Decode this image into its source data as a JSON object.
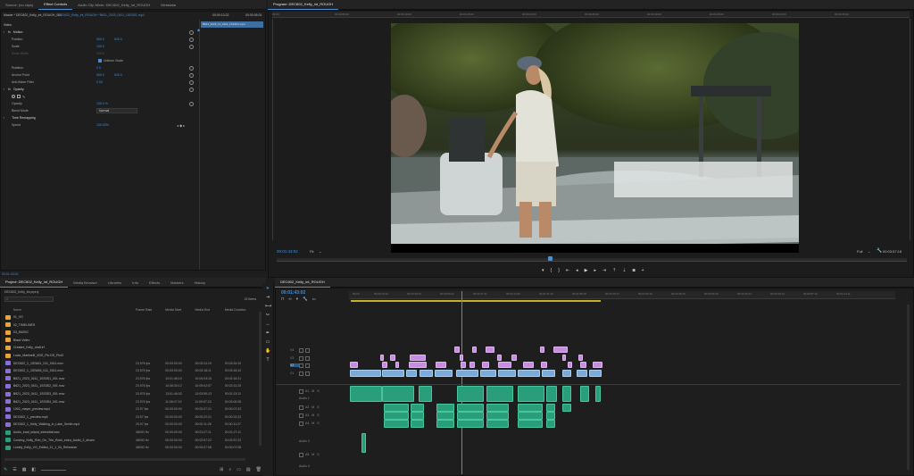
{
  "source_tabs": {
    "source": "Source: (no clips)",
    "effect_controls": "Effect Controls",
    "audio_mixer": "Audio Clip Mixer: DEC602_Kelly_int_ROUGH",
    "metadata": "Metadata"
  },
  "effect_controls": {
    "master_label": "Master * DEC602_Kelly_int_ROUGH_001",
    "clip_label": "DEC602_Kelly_int_ROUGH * B621_2023_0411_1SS3S1.mp4",
    "timecode_start": "00:00:13:22",
    "timecode_end": "00:00:05:01",
    "clip_chip": "B621_2023_11_0411_1SS3S1.mp4",
    "section_video": "Video",
    "motion": "Motion",
    "position_label": "Position",
    "position_x": "960.0",
    "position_y": "540.0",
    "scale_label": "Scale",
    "scale_value": "100.0",
    "scale_width_label": "Scale Width",
    "scale_width_value": "100.0",
    "uniform_label": "Uniform Scale",
    "rotation_label": "Rotation",
    "rotation_value": "0.0",
    "anchor_label": "Anchor Point",
    "anchor_x": "960.0",
    "anchor_y": "540.0",
    "anti_flicker_label": "Anti-flicker Filter",
    "anti_flicker_value": "0.00",
    "opacity": "Opacity",
    "opacity_label": "Opacity",
    "opacity_value": "100.0 %",
    "blend_label": "Blend Mode",
    "blend_value": "Normal",
    "time_remap": "Time Remapping",
    "speed_label": "Speed",
    "speed_value": "100.00%",
    "bottom_timecode": "00:01:43:02"
  },
  "program": {
    "title": "Program: DEC602_Kelly_int_ROUGH",
    "timecode": "00:01:43:02",
    "fit": "Fit",
    "quality": "Full",
    "duration": "00:03:57:18",
    "ruler_ticks": [
      "00:00",
      "00:00:05:00",
      "00:00:10:00",
      "00:00:15:00",
      "00:00:20:00",
      "00:00:25:00",
      "00:00:30:00",
      "00:00:35:00",
      "00:00:40:00",
      "00:00:45:00"
    ]
  },
  "project": {
    "tabs": [
      "Project: DEC602_Kelly_int_ROUGH",
      "Media Browser",
      "Libraries",
      "Info",
      "Effects",
      "Markers",
      "History"
    ],
    "path": "DEC602_Kelly_int.prproj",
    "items_count": "21 Items",
    "columns": [
      "Name",
      "Frame Rate",
      "Media Start",
      "Media End",
      "Media Duration"
    ],
    "rows": [
      {
        "name": "01_VO",
        "color": "#e8a33c",
        "fps": "",
        "start": "",
        "end": "",
        "dur": ""
      },
      {
        "name": "02_TIMELINES",
        "color": "#e8a33c",
        "fps": "",
        "start": "",
        "end": "",
        "dur": ""
      },
      {
        "name": "03_MUSIC",
        "color": "#e8a33c",
        "fps": "",
        "start": "",
        "end": "",
        "dur": ""
      },
      {
        "name": "Black Video",
        "color": "#e8a33c",
        "fps": "",
        "start": "",
        "end": "",
        "dur": ""
      },
      {
        "name": "Created_Kelly_draft.lrf",
        "color": "#e8a33c",
        "fps": "",
        "start": "",
        "end": "",
        "dur": ""
      },
      {
        "name": "Lucia_Martinelli_XDS_Pic-DS_Pict3",
        "color": "#e8a33c",
        "fps": "",
        "start": "",
        "end": "",
        "dur": ""
      },
      {
        "name": "DEC602_1_1SS461_011_0011.mov",
        "color": "#8a6fd6",
        "fps": "23.976 fps",
        "start": "00:00:00:00",
        "end": "00:03:24:19",
        "dur": "00:03:24:20"
      },
      {
        "name": "DEC602_1_1SS465_011_0011.mov",
        "color": "#8a6fd6",
        "fps": "23.976 fps",
        "start": "00:00:00:00",
        "end": "00:03:18:11",
        "dur": "00:03:18:12"
      },
      {
        "name": "B621_2023_0411_1SS3S1_001.mov",
        "color": "#8a6fd6",
        "fps": "23.976 fps",
        "start": "10:01:46:19",
        "end": "10:04:03:15",
        "dur": "00:02:16:21"
      },
      {
        "name": "B621_2023_0411_1SS3S2_001.mov",
        "color": "#8a6fd6",
        "fps": "23.976 fps",
        "start": "10:06:30:12",
        "end": "10:09:02:07",
        "dur": "00:02:31:20"
      },
      {
        "name": "B621_2023_0411_1SS3S3_001.mov",
        "color": "#8a6fd6",
        "fps": "23.976 fps",
        "start": "13:01:46:03",
        "end": "13:03:59:13",
        "dur": "00:02:13:11"
      },
      {
        "name": "B621_2023_0411_1SS3S4_001.mov",
        "color": "#8a6fd6",
        "fps": "23.976 fps",
        "start": "11:06:07:19",
        "end": "11:09:07:23",
        "dur": "00:03:00:05"
      },
      {
        "name": "1002_mayer_preview.mp4",
        "color": "#8a6fd6",
        "fps": "23.97 fps",
        "start": "00:00:00:00",
        "end": "00:00:07:21",
        "dur": "00:00:07:22"
      },
      {
        "name": "DEC602_1_preview.mp4",
        "color": "#8a6fd6",
        "fps": "23.97 fps",
        "start": "00:00:00:00",
        "end": "00:00:22:21",
        "dur": "00:00:22:22"
      },
      {
        "name": "DEC602_1_Kelly_Walking_in_Lake_Smilin.mp4",
        "color": "#8a6fd6",
        "fps": "29.97 fps",
        "start": "00:00:00:00",
        "end": "00:00:11:26",
        "dur": "00:00:11:27"
      },
      {
        "name": "Audio_boat_island_intersitial.wav",
        "color": "#2a9d7a",
        "fps": "48000 Hz",
        "start": "00:00:00:00",
        "end": "00:01:27:11",
        "dur": "00:01:27:11"
      },
      {
        "name": "Cowboy_Kelly_Rob_On_The_Rock_extra_Audio_2_divam",
        "color": "#2a9d7a",
        "fps": "48000 Hz",
        "start": "00:00:00:00",
        "end": "00:02:57:22",
        "dur": "00:02:57:22"
      },
      {
        "name": "Lonely_Kelly_VO_Edited_11_1_04_Rehearse",
        "color": "#2a9d7a",
        "fps": "48000 Hz",
        "start": "00:00:00:00",
        "end": "00:00:07:08",
        "dur": "00:00:07:08"
      }
    ]
  },
  "timeline": {
    "tab": "DEC602_Kelly_int_ROUGH",
    "timecode": "00:01:43:02",
    "ruler_ticks": [
      "00:00",
      "00:00:16:23",
      "00:00:33:23",
      "00:00:50:22",
      "00:01:07:21",
      "00:01:24:20",
      "00:01:41:19",
      "00:01:58:18",
      "00:02:15:17",
      "00:02:32:16",
      "00:02:49:16",
      "00:03:06:15",
      "00:03:23:14",
      "00:03:40:13",
      "00:03:57:12",
      "00:04:14:11"
    ],
    "tracks": {
      "v4": "V4",
      "v3": "V3",
      "v2": "V2",
      "v1": "V1",
      "a1": "A1",
      "audio1": "Audio 1",
      "a2": "A2",
      "a3": "A3",
      "a4": "A4",
      "audio3": "Audio 3",
      "a5": "A5",
      "audio4": "Audio 4"
    }
  },
  "colors": {
    "accent_blue": "#3f8fdd",
    "video_clip": "#c78de0",
    "blue_clip": "#7ba9d8",
    "audio_clip": "#2a9d7a",
    "playhead": "#4d8fd6"
  }
}
